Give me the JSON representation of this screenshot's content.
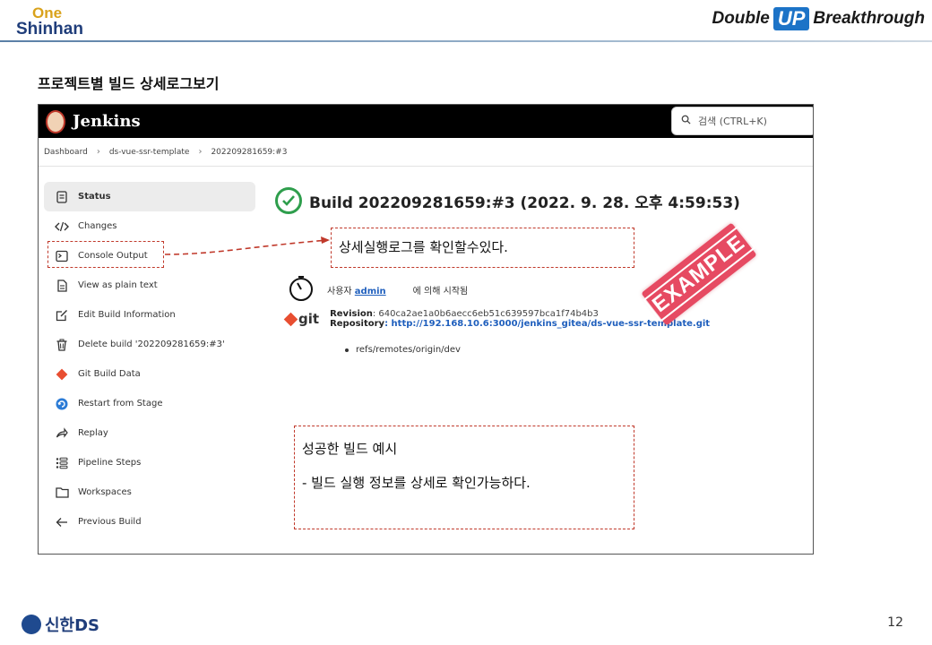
{
  "header": {
    "logo_top": "One",
    "logo_bottom": "Shinhan",
    "brand_left": "Double",
    "brand_mid": "UP",
    "brand_right": "Breakthrough"
  },
  "page_heading": "프로젝트별 빌드 상세로그보기",
  "jenkins": {
    "title": "Jenkins",
    "search_placeholder": "검색 (CTRL+K)",
    "breadcrumb": [
      "Dashboard",
      "ds-vue-ssr-template",
      "202209281659:#3"
    ],
    "sidebar": [
      {
        "label": "Status",
        "icon": "status-icon"
      },
      {
        "label": "Changes",
        "icon": "code-icon"
      },
      {
        "label": "Console Output",
        "icon": "terminal-icon"
      },
      {
        "label": "View as plain text",
        "icon": "document-icon"
      },
      {
        "label": "Edit Build Information",
        "icon": "edit-icon"
      },
      {
        "label": "Delete build '202209281659:#3'",
        "icon": "trash-icon"
      },
      {
        "label": "Git Build Data",
        "icon": "git-icon"
      },
      {
        "label": "Restart from Stage",
        "icon": "restart-icon"
      },
      {
        "label": "Replay",
        "icon": "replay-icon"
      },
      {
        "label": "Pipeline Steps",
        "icon": "steps-icon"
      },
      {
        "label": "Workspaces",
        "icon": "folder-icon"
      },
      {
        "label": "Previous Build",
        "icon": "arrow-left-icon"
      }
    ],
    "build_title": "Build 202209281659:#3 (2022. 9. 28. 오후 4:59:53)",
    "started_prefix": "사용자",
    "started_user": "admin",
    "started_suffix": "에 의해 시작됨",
    "git_label": "git",
    "revision_label": "Revision",
    "revision_value": ": 640ca2ae1a0b6aecc6eb51c639597bca1f74b4b3",
    "repository_label": "Repository",
    "repository_value": ": http://192.168.10.6:3000/jenkins_gitea/ds-vue-ssr-template.git",
    "ref": "refs/remotes/origin/dev"
  },
  "callouts": {
    "console_note": "상세실행로그를 확인할수있다.",
    "example_title": "성공한 빌드 예시",
    "example_desc": "- 빌드 실행 정보를 상세로 확인가능하다."
  },
  "stamp": "EXAMPLE",
  "footer": {
    "logo_text": "신한DS",
    "page_number": "12"
  },
  "colors": {
    "accent_red": "#c0392b",
    "success_green": "#2e9e4c",
    "link_blue": "#1f5fbd",
    "stamp_pink": "#e64a62"
  }
}
